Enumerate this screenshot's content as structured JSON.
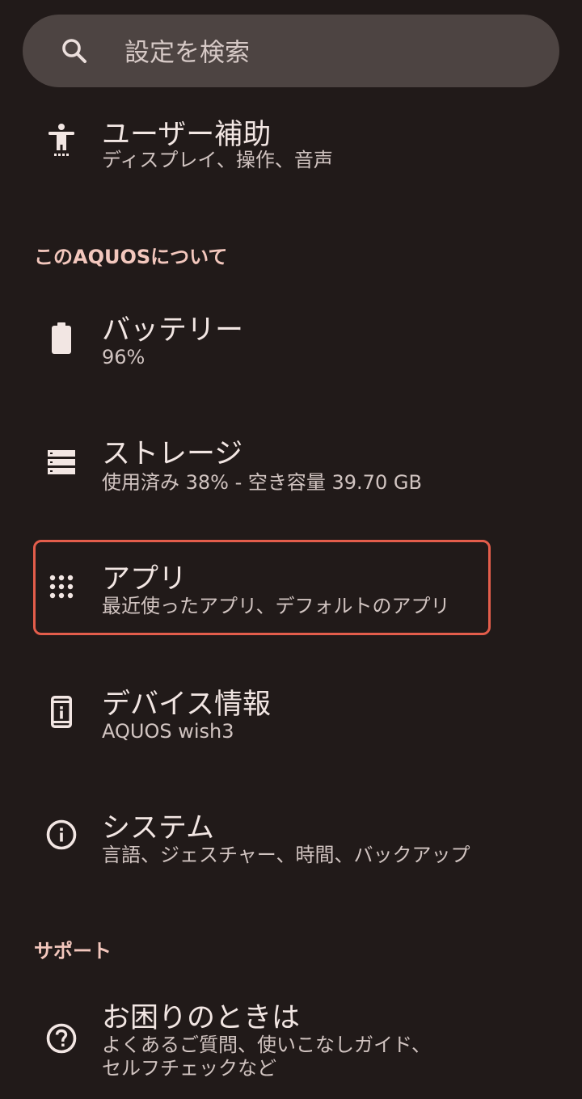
{
  "search": {
    "placeholder": "設定を検索"
  },
  "sections": {
    "about_header": "このAQUOSについて",
    "support_header": "サポート"
  },
  "items": {
    "accessibility": {
      "title": "ユーザー補助",
      "subtitle": "ディスプレイ、操作、音声"
    },
    "battery": {
      "title": "バッテリー",
      "subtitle": "96%"
    },
    "storage": {
      "title": "ストレージ",
      "subtitle": "使用済み 38% - 空き容量 39.70 GB"
    },
    "apps": {
      "title": "アプリ",
      "subtitle": "最近使ったアプリ、デフォルトのアプリ"
    },
    "device_info": {
      "title": "デバイス情報",
      "subtitle": "AQUOS wish3"
    },
    "system": {
      "title": "システム",
      "subtitle": "言語、ジェスチャー、時間、バックアップ"
    },
    "help": {
      "title": "お困りのときは",
      "subtitle_line1": "よくあるご質問、使いこなしガイド、",
      "subtitle_line2": "セルフチェックなど"
    }
  },
  "colors": {
    "background": "#211a19",
    "search_bg": "#4d4442",
    "section_header": "#f3c7bd",
    "highlight": "#e35d4b"
  }
}
